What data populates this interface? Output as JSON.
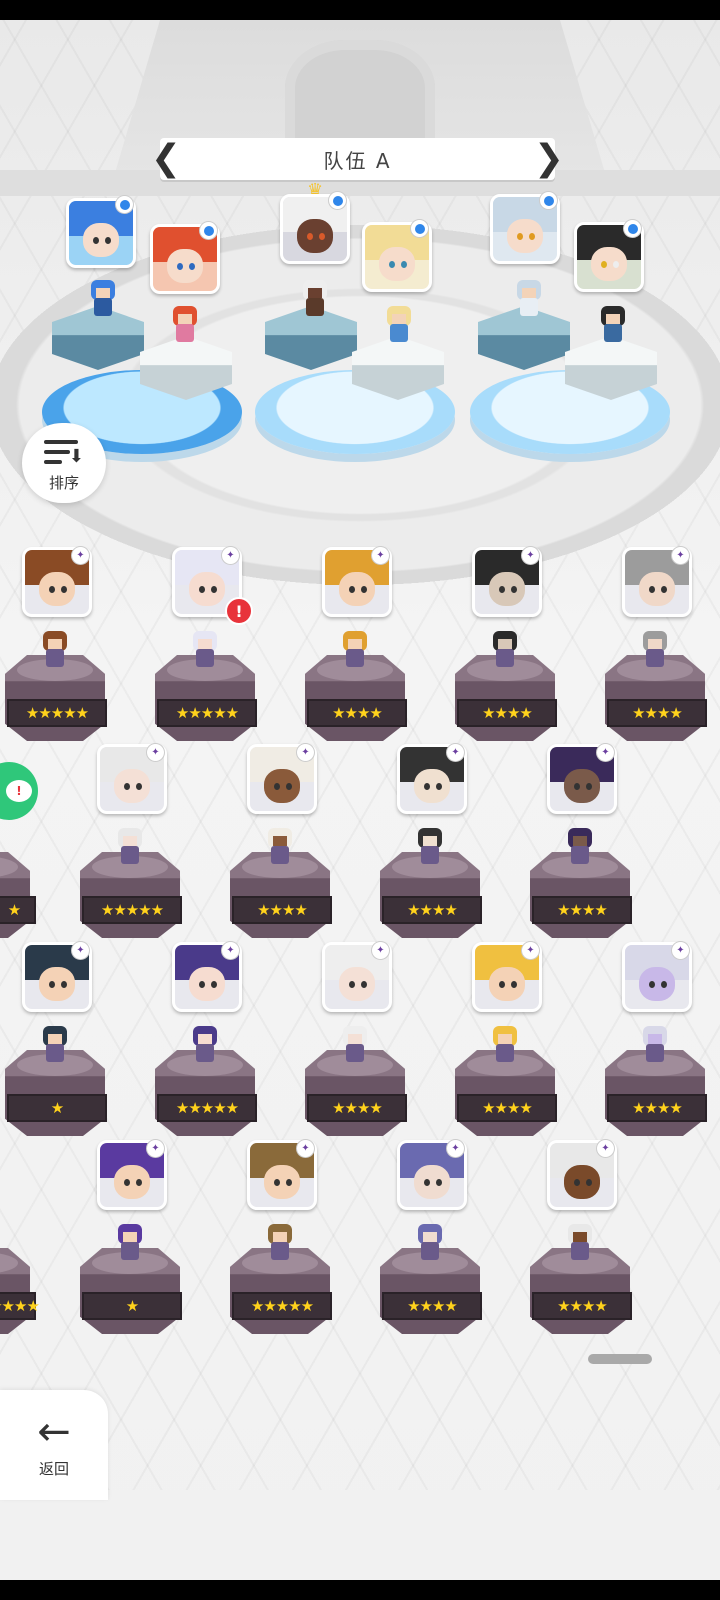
{
  "header": {
    "team_title": "队伍 A",
    "prev_arrow": "❮",
    "next_arrow": "❯"
  },
  "colors": {
    "slot_blue": "#2d7ad6",
    "pedestal": "#6a5565",
    "star": "#ffd21c",
    "alert": "#e8333b",
    "chat_green": "#2fc77a"
  },
  "sort_button": {
    "label": "排序",
    "icon": "sort-descending-icon"
  },
  "back_button": {
    "label": "返回",
    "arrow": "←",
    "icon": "back-arrow-icon"
  },
  "chat_button": {
    "icon": "chat-alert-icon",
    "glyph": "!"
  },
  "team_slots": [
    {
      "slot": 1,
      "favorite": true,
      "favorite_glyph": "★",
      "hero_a": "blue-hair-girl",
      "hero_b": "red-hair-girl"
    },
    {
      "slot": 2,
      "leader": true,
      "leader_glyph": "♛",
      "hero_a": "white-hair-dark-skin",
      "hero_b": "blonde-girl"
    },
    {
      "slot": 3,
      "hero_a": "silver-hair-girl",
      "hero_b": "black-hair-masked"
    }
  ],
  "roster": [
    {
      "stars": "★★★★★",
      "hair": "#8a4b25",
      "skin": "#f4d2b6"
    },
    {
      "stars": "★★★★★",
      "hair": "#e6e6f4",
      "skin": "#f6dcd0",
      "alert": "!"
    },
    {
      "stars": "★★★★",
      "hair": "#e0a030",
      "skin": "#f4d2b6"
    },
    {
      "stars": "★★★★",
      "hair": "#2a2a2a",
      "skin": "#d8c8b8"
    },
    {
      "stars": "★★★★",
      "hair": "#9c9c9c",
      "skin": "#f0d8c8"
    },
    {
      "stars": "★",
      "hair": "#6a4a2a",
      "skin": "#f4d2b6"
    },
    {
      "stars": "★★★★★",
      "hair": "#e8e8e8",
      "skin": "#f4e0d6"
    },
    {
      "stars": "★★★★",
      "hair": "#f0ece4",
      "skin": "#8a5a3a"
    },
    {
      "stars": "★★★★",
      "hair": "#333333",
      "skin": "#f0e0d0"
    },
    {
      "stars": "★★★★",
      "hair": "#3a2a5a",
      "skin": "#7a5a4a"
    },
    {
      "stars": "★",
      "hair": "#2a3a4a",
      "skin": "#f4d2b6"
    },
    {
      "stars": "★★★★★",
      "hair": "#4a3a8a",
      "skin": "#f6dcd0"
    },
    {
      "stars": "★★★★",
      "hair": "#eeeeee",
      "skin": "#f4e0d6"
    },
    {
      "stars": "★★★★",
      "hair": "#f0c040",
      "skin": "#f4d2b6"
    },
    {
      "stars": "★★★★",
      "hair": "#d8d8e8",
      "skin": "#c8b8e8"
    },
    {
      "stars": "★★★★",
      "hair": "#e8d8a8",
      "skin": "#f4d2b6"
    },
    {
      "stars": "★",
      "hair": "#5a3aa0",
      "skin": "#f4d2b6"
    },
    {
      "stars": "★★★★★",
      "hair": "#8a6a3a",
      "skin": "#f4d2b6"
    },
    {
      "stars": "★★★★",
      "hair": "#6a6ab0",
      "skin": "#f0dcd0"
    },
    {
      "stars": "★★★★",
      "hair": "#e8e8e8",
      "skin": "#7a4a2a"
    },
    {
      "stars": "★★★★",
      "hair": "#e05a20",
      "skin": "#f4d2b6"
    },
    {
      "stars": "★",
      "hair": "#3a3a6a",
      "skin": "#f4d2b6"
    }
  ]
}
